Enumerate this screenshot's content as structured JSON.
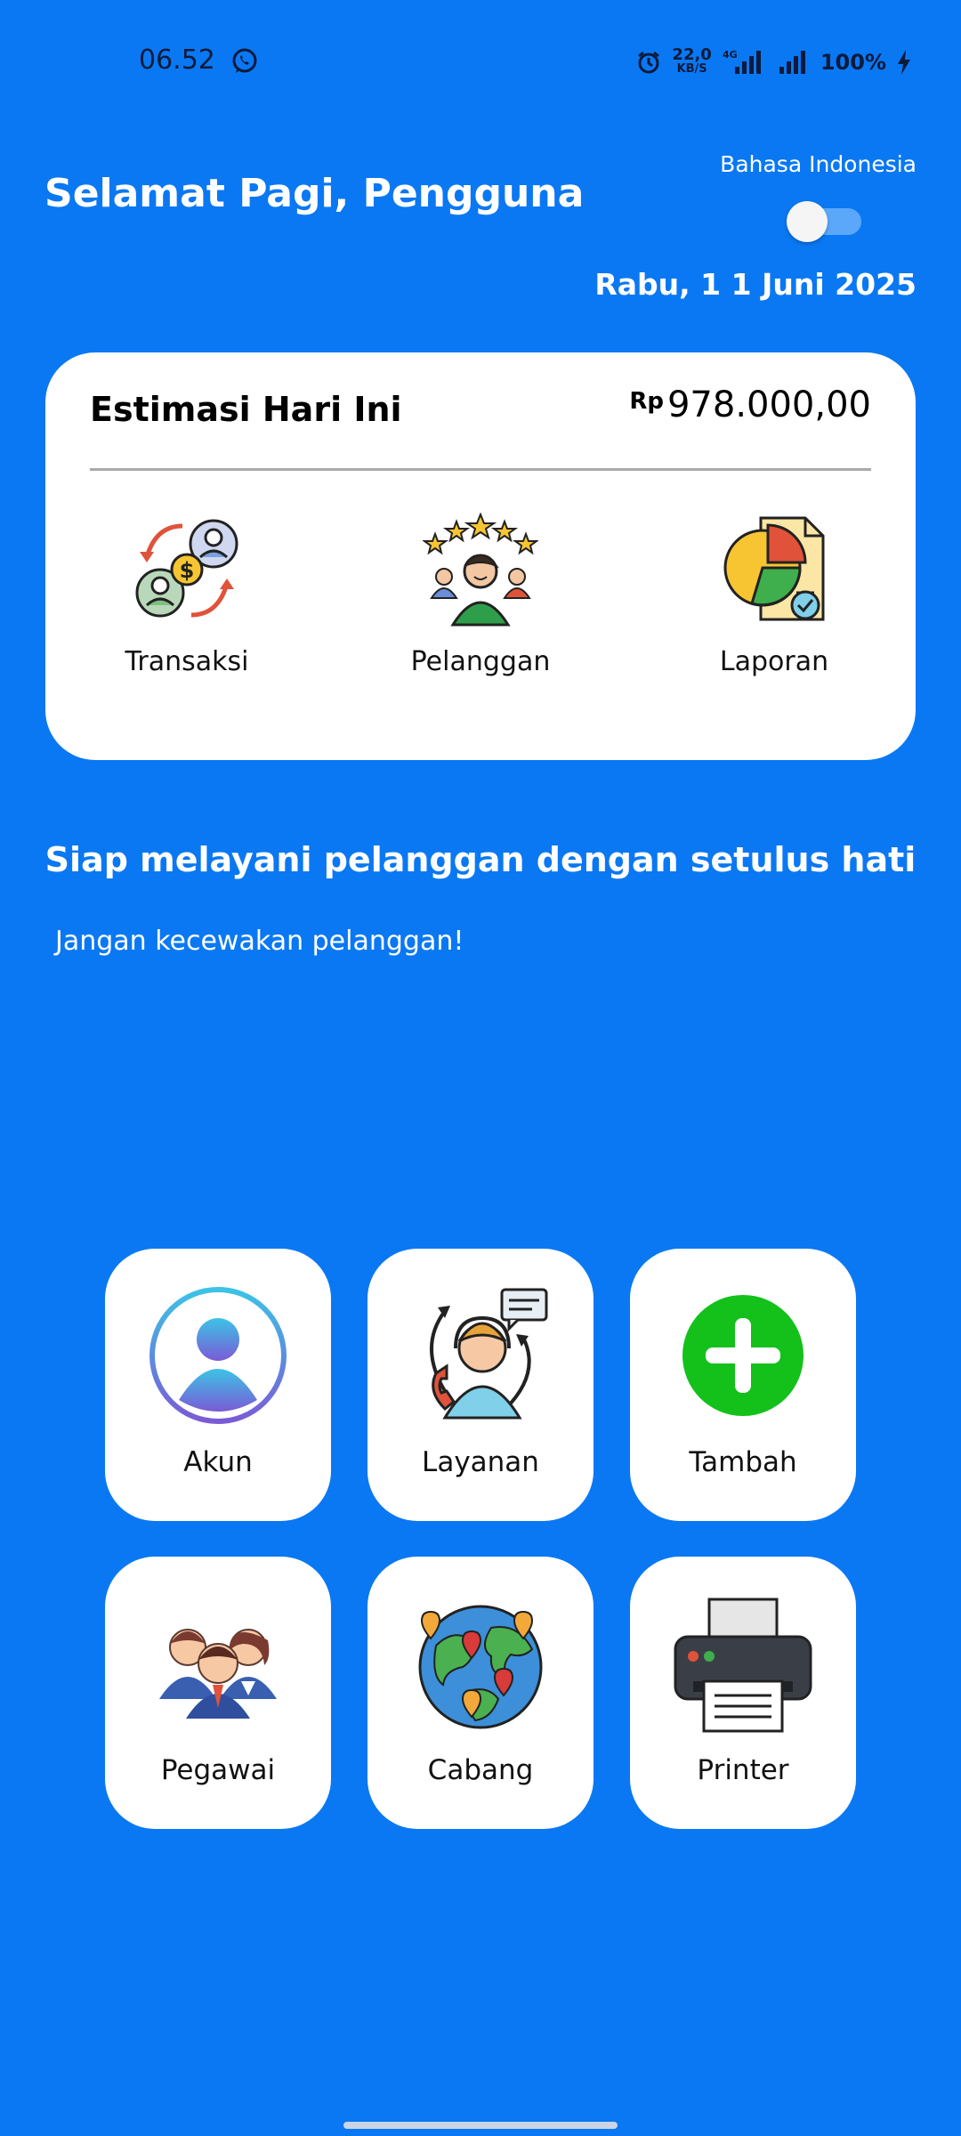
{
  "status_bar": {
    "time": "06.52",
    "network_speed_value": "22,0",
    "network_speed_unit": "KB/S",
    "network_type": "4G",
    "battery": "100%"
  },
  "header": {
    "greeting": "Selamat Pagi, Pengguna",
    "language_label": "Bahasa Indonesia",
    "language_toggle_on": false,
    "date": "Rabu, 1 1 Juni 2025"
  },
  "summary": {
    "title": "Estimasi Hari Ini",
    "currency": "Rp",
    "amount": "978.000,00",
    "quick_actions": [
      {
        "label": "Transaksi",
        "icon": "transaction-icon"
      },
      {
        "label": "Pelanggan",
        "icon": "customer-rating-icon"
      },
      {
        "label": "Laporan",
        "icon": "report-icon"
      }
    ]
  },
  "tagline": "Siap melayani pelanggan dengan setulus hati",
  "subtagline": "Jangan kecewakan pelanggan!",
  "menu": [
    {
      "label": "Akun",
      "icon": "account-icon"
    },
    {
      "label": "Layanan",
      "icon": "customer-service-icon"
    },
    {
      "label": "Tambah",
      "icon": "add-icon"
    },
    {
      "label": "Pegawai",
      "icon": "employees-icon"
    },
    {
      "label": "Cabang",
      "icon": "branch-map-icon"
    },
    {
      "label": "Printer",
      "icon": "printer-icon"
    }
  ],
  "colors": {
    "background": "#0a78f3",
    "card": "#ffffff",
    "add_green": "#13c11a"
  }
}
